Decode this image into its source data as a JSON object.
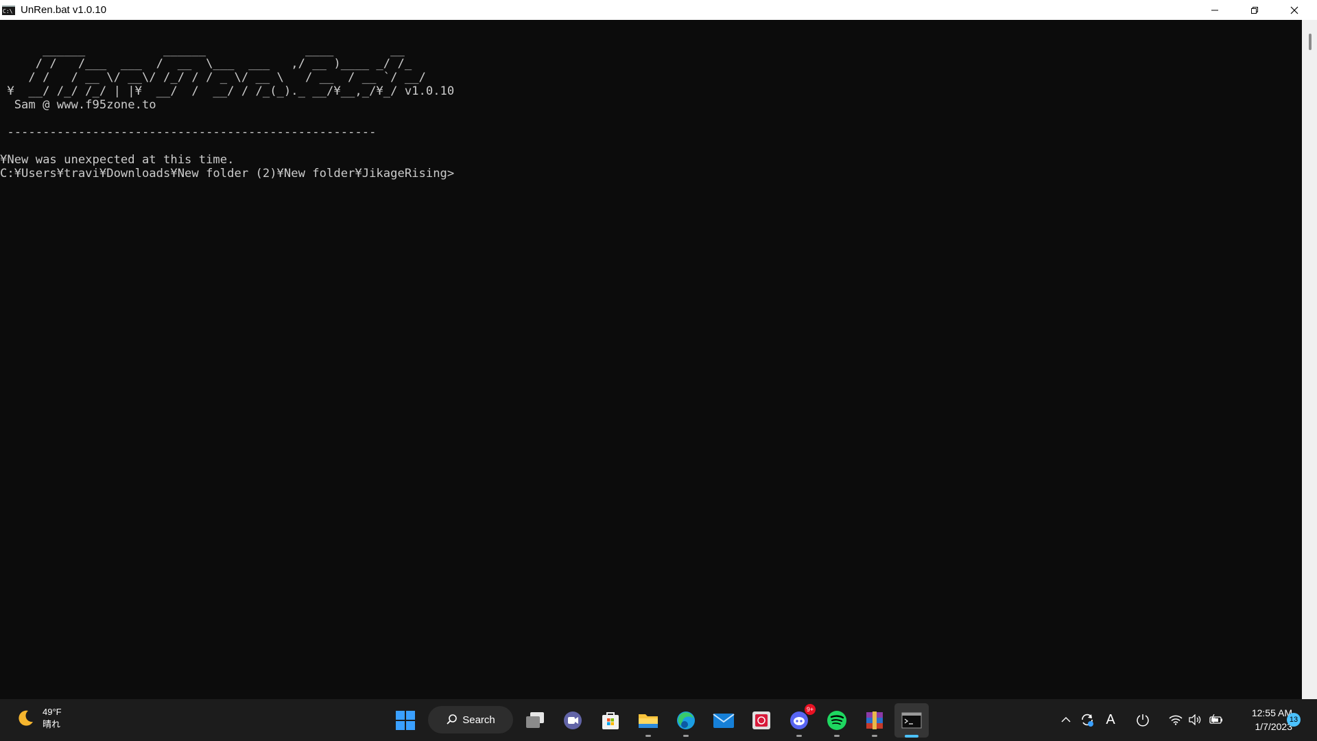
{
  "window": {
    "title": "UnRen.bat v1.0.10",
    "icon_label": "C:\\"
  },
  "console": {
    "lines": [
      "      ______           ______              ____        __ ",
      "     / /   /___  ___  /  __  \\___  ___   ,/ __ )____ _/ /_",
      "    / /   / __ \\/ __\\/ /_/ / / _ \\/ __ \\   / __  / __ `/ __/",
      " ¥  __/ /_/ /_/ | |¥  __/  /  __/ / /_(_)._ __/¥__,_/¥_/ v1.0.10",
      "  Sam @ www.f95zone.to",
      "",
      " ----------------------------------------------------",
      "",
      "¥New was unexpected at this time.",
      "C:¥Users¥travi¥Downloads¥New folder (2)¥New folder¥JikageRising>"
    ]
  },
  "taskbar": {
    "weather": {
      "temp": "49°F",
      "condition": "晴れ"
    },
    "search_label": "Search",
    "discord_badge": "9+",
    "clock": {
      "time": "12:55 AM",
      "date": "1/7/2023"
    },
    "notification_count": "13",
    "ime_label": "A",
    "accent": "#4cc2ff"
  }
}
